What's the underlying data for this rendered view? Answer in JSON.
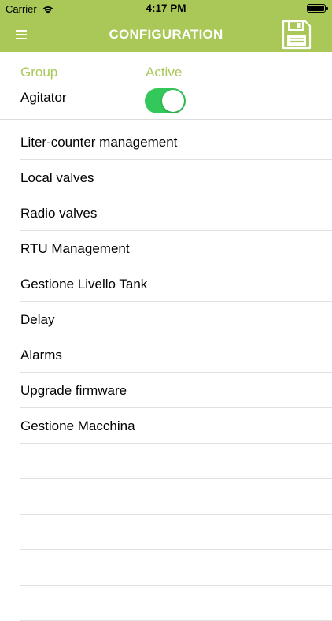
{
  "status_bar": {
    "carrier": "Carrier",
    "time": "4:17 PM"
  },
  "nav": {
    "title": "CONFIGURATION",
    "menu_icon": "hamburger-menu-icon",
    "save_icon": "floppy-disk-save-icon"
  },
  "colors": {
    "brand": "#a9c857",
    "toggle_on": "#34c759"
  },
  "group_header": {
    "group_label": "Group",
    "active_label": "Active",
    "group_name": "Agitator",
    "active": true
  },
  "menu_items": [
    {
      "label": "Liter-counter management"
    },
    {
      "label": "Local valves"
    },
    {
      "label": "Radio valves"
    },
    {
      "label": "RTU Management"
    },
    {
      "label": "Gestione Livello Tank"
    },
    {
      "label": "Delay"
    },
    {
      "label": "Alarms"
    },
    {
      "label": "Upgrade firmware"
    },
    {
      "label": "Gestione Macchina"
    }
  ]
}
